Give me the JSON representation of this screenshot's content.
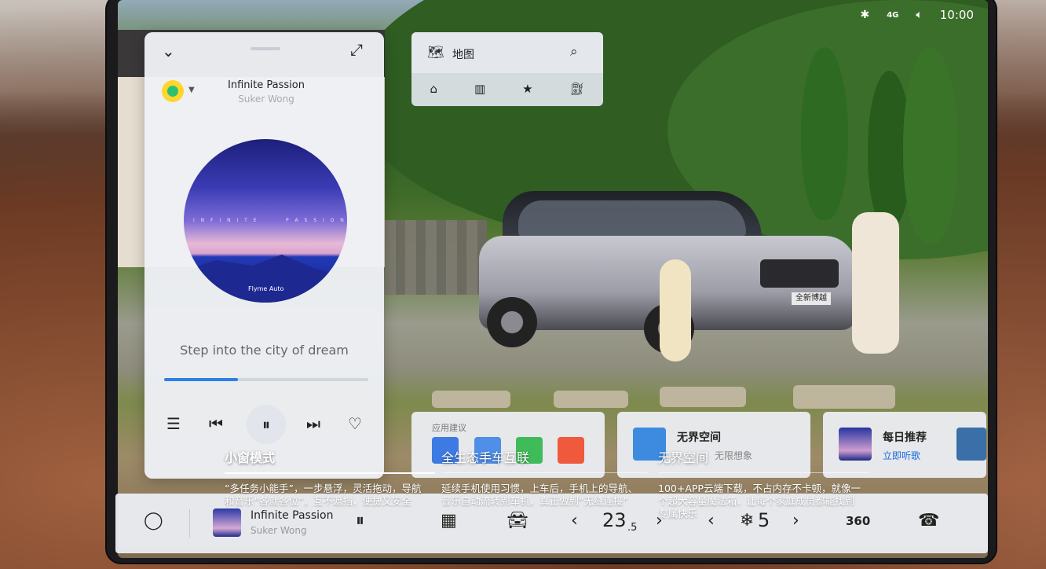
{
  "status_bar": {
    "bluetooth_icon": "bluetooth-icon",
    "signal_label": "4G",
    "volume_icon": "volume-icon",
    "time": "10:00"
  },
  "music_card": {
    "title": "Infinite Passion",
    "artist": "Suker Wong",
    "cover_text_left": "I N F I N I T E",
    "cover_text_right": "P A S S I O N",
    "cover_signature": "Flyme Auto",
    "lyric": "Step into the city of dream",
    "progress": 0.36
  },
  "map_widget": {
    "label": "地图",
    "shortcuts": [
      "home-icon",
      "company-icon",
      "favorite-folder-icon",
      "gas-station-icon"
    ]
  },
  "cards": {
    "suggestion_label": "应用建议",
    "cloud_title": "无界空间",
    "cloud_sub": "无限想象",
    "daily_title": "每日推荐",
    "daily_link": "立即听歌",
    "plate": "全新博越"
  },
  "overlay": {
    "col1_title": "小窗模式",
    "col1_body": "“多任务小能手”，一步悬浮，灵活拖动，导航和音乐“各就各位”，互不遮挡，便捷又安全",
    "col2_title": "全生态手车互联",
    "col2_body": "延续手机使用习惯，上车后，手机上的导航、音乐自动流转到车机，真正做到“无缝连接”",
    "col3_title": "无界空间",
    "col3_body": "100+APP云端下载，不占内存不卡顿，就像一个超大容量魔法箱，让每个家庭成员都能找到专属快乐"
  },
  "dock": {
    "track_title": "Infinite Passion",
    "track_artist": "Suker Wong",
    "temp_main": "23",
    "temp_decimal": ".5",
    "fan_speed": "5",
    "view_360": "360"
  }
}
